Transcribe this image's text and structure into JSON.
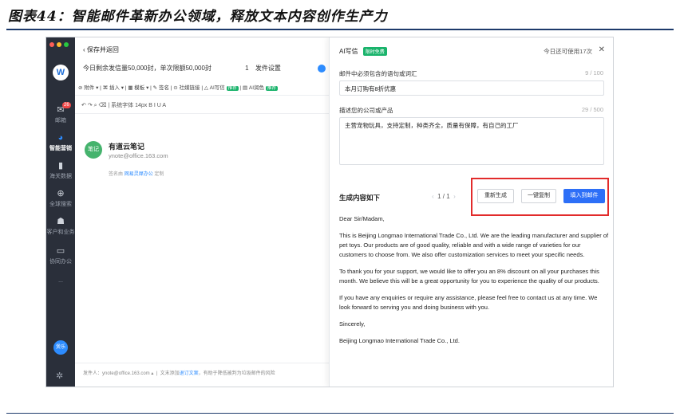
{
  "caption": "图表44：智能邮件革新办公领域，释放文本内容创作生产力",
  "nav": {
    "items": [
      {
        "label": "邮箱",
        "badge": "26"
      },
      {
        "label": "智能营销"
      },
      {
        "label": "海关数据"
      },
      {
        "label": "全球搜索"
      },
      {
        "label": "客户和业务"
      },
      {
        "label": "协同办公"
      },
      {
        "label": "..."
      }
    ],
    "user_avatar": "煲乐"
  },
  "compose": {
    "back_label": "保存并返回",
    "quota_text": "今日剩余发信量50,000封，单次限额50,000封",
    "send_number": "1",
    "send_settings": "发件设置",
    "toolbar": [
      "附件",
      "插入",
      "模板",
      "签名",
      "社媒链接",
      "AI写信",
      "AI润色"
    ],
    "toolbar_tags": [
      "推荐",
      "推荐"
    ],
    "format_bar": "系统字体  14px  B  I  U  A",
    "signature": {
      "avatar": "笔记",
      "name": "有道云笔记",
      "email": "ynote@office.163.com",
      "note_prefix": "签名由",
      "note_link": "网易灵犀办公",
      "note_suffix": "定制"
    },
    "footer": {
      "sender": "发件人：ynote@office.163.com",
      "tip_prefix": "文末添加",
      "tip_link": "退订文案",
      "tip_suffix": "，有助于降低被判为垃圾邮件的风险"
    }
  },
  "panel": {
    "title": "AI写信",
    "free_tag": "限时免费",
    "quota": "今日还可使用17次",
    "close": "✕",
    "field1": {
      "label": "邮件中必须包含的语句或词汇",
      "count": "9 / 100",
      "value": "本月订购有8折优惠"
    },
    "field2": {
      "label": "描述您的公司或产品",
      "count": "29 / 500",
      "value": "主营宠物玩具，支持定制，种类齐全，质量有保障，有自己的工厂"
    },
    "output_title": "生成内容如下",
    "pager": "1 / 1",
    "buttons": {
      "regenerate": "重新生成",
      "copy": "一键复制",
      "insert": "填入到邮件"
    },
    "letter": [
      "Dear Sir/Madam,",
      "This is Beijing Longmao International Trade Co., Ltd. We are the leading manufacturer and supplier of pet toys. Our products are of good quality, reliable and with a wide range of varieties for our customers to choose from. We also offer customization services to meet your specific needs.",
      "To thank you for your support, we would like to offer you an 8% discount on all your purchases this month. We believe this will be a great opportunity for you to experience the quality of our products.",
      "If you have any enquiries or require any assistance, please feel free to contact us at any time. We look forward to serving you and doing business with you.",
      "Sincerely,",
      "Beijing Longmao International Trade Co., Ltd."
    ]
  },
  "colors": {
    "accent": "#2d6ff7",
    "highlight": "#e22b2b",
    "nav_bg": "#2a2f3a",
    "tag_green": "#19b36b"
  }
}
